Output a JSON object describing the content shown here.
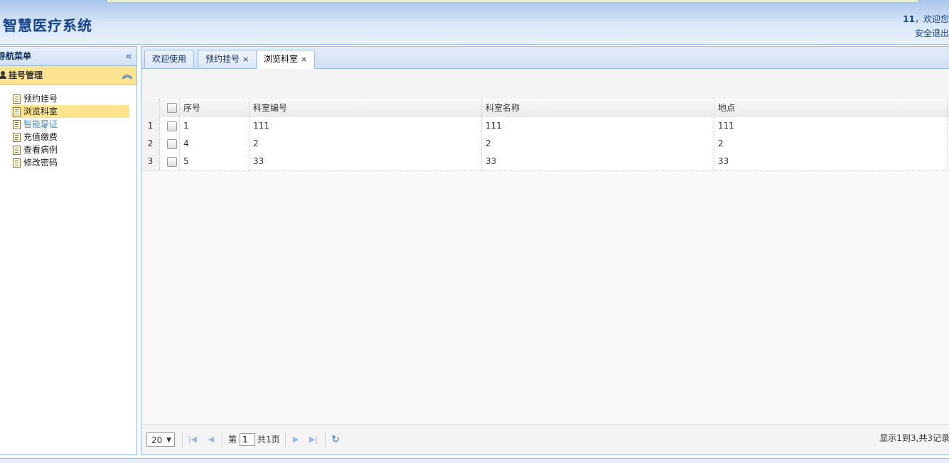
{
  "app": {
    "title": "智慧医疗系统",
    "user": "11",
    "welcome": "，欢迎您",
    "logout": "安全退出"
  },
  "sidebar": {
    "title": "导航菜单",
    "group": "挂号管理",
    "items": [
      {
        "label": "预约挂号"
      },
      {
        "label": "浏览科室"
      },
      {
        "label": "智能导证"
      },
      {
        "label": "充值缴费"
      },
      {
        "label": "查看病例"
      },
      {
        "label": "修改密码"
      }
    ]
  },
  "tabs": [
    {
      "label": "欢迎使用"
    },
    {
      "label": "预约挂号",
      "close": "×"
    },
    {
      "label": "浏览科室",
      "close": "×"
    }
  ],
  "grid": {
    "columns": [
      "序号",
      "科室编号",
      "科室名称",
      "地点"
    ],
    "rows": [
      {
        "num": "1",
        "cells": [
          "1",
          "111",
          "111",
          "111"
        ]
      },
      {
        "num": "2",
        "cells": [
          "4",
          "2",
          "2",
          "2"
        ]
      },
      {
        "num": "3",
        "cells": [
          "5",
          "33",
          "33",
          "33"
        ]
      }
    ]
  },
  "pager": {
    "page_size": "20",
    "page_prefix": "第",
    "page_value": "1",
    "page_suffix": "共1页",
    "info": "显示1到3,共3记录"
  },
  "icons": {
    "collapse": "double-chevron-left-icon",
    "group_collapse": "double-chevron-up-icon",
    "first": "first-page-icon",
    "prev": "prev-page-icon",
    "next": "next-page-icon",
    "last": "last-page-icon",
    "refresh": "refresh-icon"
  },
  "colors": {
    "header_text": "#15428b",
    "selection": "#fbe38f",
    "border": "#99bbe8"
  }
}
